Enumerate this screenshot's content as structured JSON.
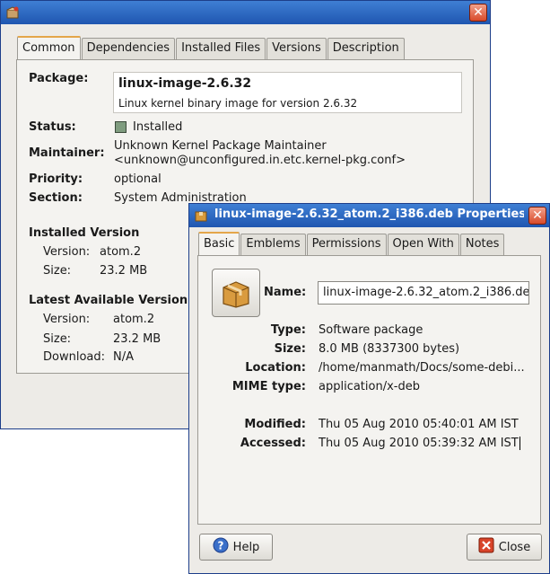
{
  "back_window": {
    "tabs": [
      "Common",
      "Dependencies",
      "Installed Files",
      "Versions",
      "Description"
    ],
    "active_tab": "Common",
    "package_label": "Package:",
    "package_name": "linux-image-2.6.32",
    "package_desc": "Linux kernel binary image for version 2.6.32",
    "status_label": "Status:",
    "status_value": "Installed",
    "maintainer_label": "Maintainer:",
    "maintainer_line1": "Unknown Kernel Package Maintainer",
    "maintainer_line2": "<unknown@unconfigured.in.etc.kernel-pkg.conf>",
    "priority_label": "Priority:",
    "priority_value": "optional",
    "section_label": "Section:",
    "section_value": "System Administration",
    "installed_heading": "Installed Version",
    "installed_version_label": "Version:",
    "installed_version_value": "atom.2",
    "installed_size_label": "Size:",
    "installed_size_value": "23.2 MB",
    "latest_heading": "Latest Available Version",
    "latest_version_label": "Version:",
    "latest_version_value": "atom.2",
    "latest_size_label": "Size:",
    "latest_size_value": "23.2 MB",
    "download_label": "Download:",
    "download_value": "N/A"
  },
  "front_window": {
    "title": "linux-image-2.6.32_atom.2_i386.deb Properties",
    "tabs": [
      "Basic",
      "Emblems",
      "Permissions",
      "Open With",
      "Notes"
    ],
    "active_tab": "Basic",
    "name_label": "Name:",
    "name_value": "linux-image-2.6.32_atom.2_i386.de",
    "type_label": "Type:",
    "type_value": "Software package",
    "size_label": "Size:",
    "size_value": "8.0 MB (8337300 bytes)",
    "location_label": "Location:",
    "location_value": "/home/manmath/Docs/some-debi...",
    "mime_label": "MIME type:",
    "mime_value": "application/x-deb",
    "modified_label": "Modified:",
    "modified_value": "Thu 05 Aug 2010 05:40:01 AM IST",
    "accessed_label": "Accessed:",
    "accessed_value": "Thu 05 Aug 2010 05:39:32 AM IST",
    "help_button": "Help",
    "close_button": "Close"
  },
  "icons": {
    "close": "close-icon",
    "package": "package-icon",
    "help": "help-icon"
  },
  "colors": {
    "titlebar": "#2a66c4",
    "close_button": "#d84a2a",
    "tab_highlight": "#e4a64a",
    "status_installed": "#7f9c7f"
  }
}
